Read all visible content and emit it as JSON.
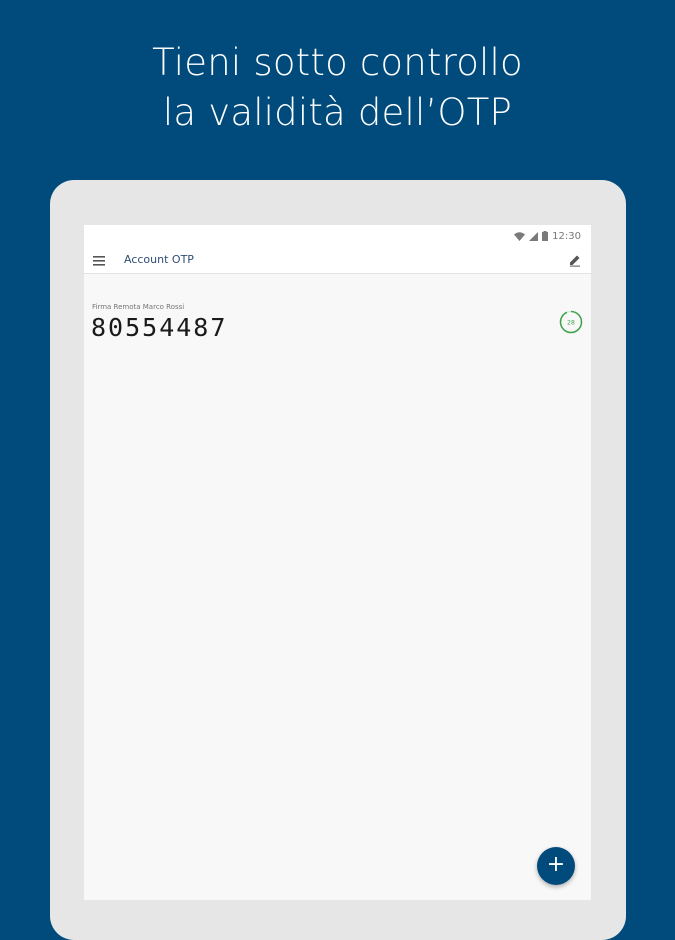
{
  "headline": {
    "line1": "Tieni sotto controllo",
    "line2": "la validità dell’OTP"
  },
  "statusbar": {
    "time": "12:30",
    "icons": [
      "wifi-icon",
      "signal-icon",
      "battery-icon"
    ]
  },
  "toolbar": {
    "title": "Account OTP",
    "menu_icon": "menu-icon",
    "edit_icon": "edit-icon"
  },
  "otp_items": [
    {
      "label": "Firma Remota Marco Rossi",
      "code": "80554487",
      "timer_value": "28",
      "timer_fraction": 0.93
    }
  ],
  "fab": {
    "label": "+",
    "icon": "add-icon"
  },
  "colors": {
    "background": "#014b7c",
    "tablet_frame": "#e6e6e6",
    "timer_ring": "#3fa34d",
    "fab": "#014b7c"
  }
}
